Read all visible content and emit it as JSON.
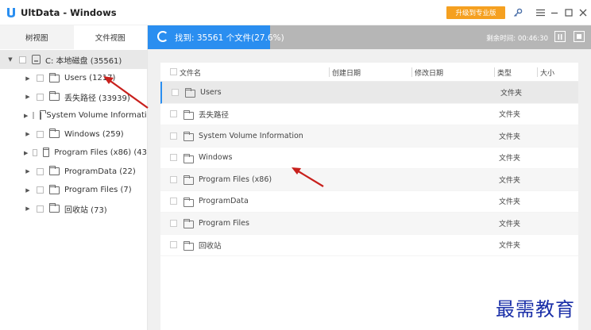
{
  "app": {
    "title": "UltData - Windows",
    "upgrade_label": "升级到专业版"
  },
  "sidebar": {
    "tabs": [
      {
        "label": "树视图"
      },
      {
        "label": "文件视图"
      }
    ],
    "root": {
      "label": "C: 本地磁盘 (35561)"
    },
    "items": [
      {
        "label": "Users (1217)"
      },
      {
        "label": "丢失路径 (33939)"
      },
      {
        "label": "System Volume Information"
      },
      {
        "label": "Windows (259)"
      },
      {
        "label": "Program Files (x86) (43"
      },
      {
        "label": "ProgramData (22)"
      },
      {
        "label": "Program Files (7)"
      },
      {
        "label": "回收站 (73)"
      }
    ]
  },
  "scan": {
    "status": "找到: 35561 个文件(27.6%)",
    "progress": 0.276,
    "remaining": "剩余时间: 00:46:30"
  },
  "table": {
    "columns": [
      "文件名",
      "创建日期",
      "修改日期",
      "类型",
      "大小"
    ],
    "rows": [
      {
        "name": "Users",
        "type": "文件夹"
      },
      {
        "name": "丢失路径",
        "type": "文件夹"
      },
      {
        "name": "System Volume Information",
        "type": "文件夹"
      },
      {
        "name": "Windows",
        "type": "文件夹"
      },
      {
        "name": "Program Files (x86)",
        "type": "文件夹"
      },
      {
        "name": "ProgramData",
        "type": "文件夹"
      },
      {
        "name": "Program Files",
        "type": "文件夹"
      },
      {
        "name": "回收站",
        "type": "文件夹"
      }
    ]
  },
  "watermark": "最需教育",
  "colors": {
    "accent": "#2a8ef0",
    "upgrade": "#f5a020",
    "annotation": "#c8201c",
    "watermark": "#1a2fa8"
  }
}
